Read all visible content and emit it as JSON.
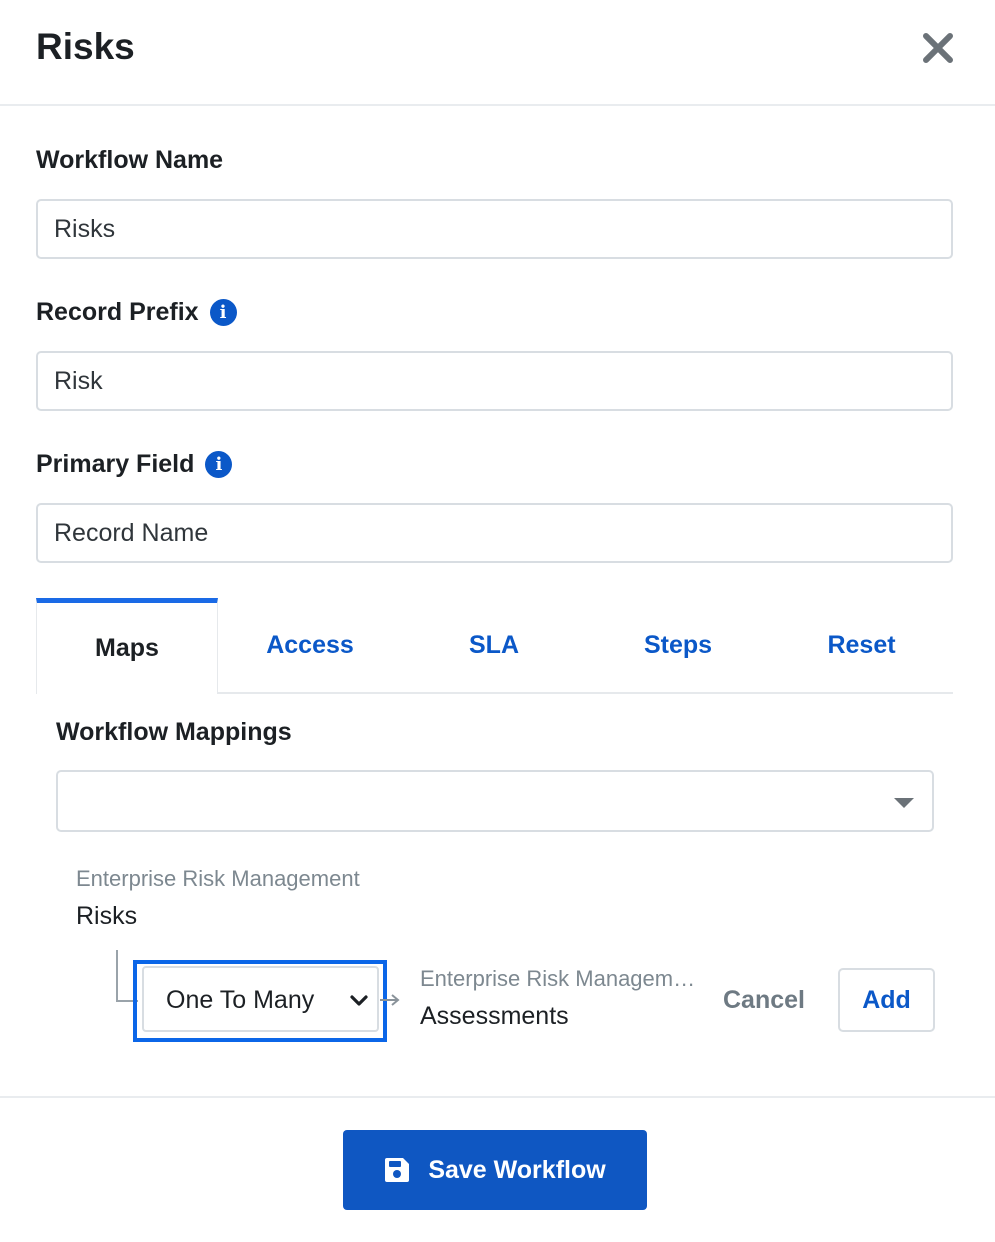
{
  "colors": {
    "accent": "#0b58c8",
    "focus_outline": "#0b66e8",
    "save_button": "#0f57c2",
    "muted_text": "#7d8890"
  },
  "header": {
    "title": "Risks",
    "close_icon": "close-icon"
  },
  "form": {
    "workflow_name": {
      "label": "Workflow Name",
      "value": "Risks"
    },
    "record_prefix": {
      "label": "Record Prefix",
      "value": "Risk",
      "icon": "info-icon"
    },
    "primary_field": {
      "label": "Primary Field",
      "value": "Record Name",
      "icon": "info-icon"
    }
  },
  "tabs": [
    {
      "label": "Maps",
      "active": true
    },
    {
      "label": "Access",
      "active": false
    },
    {
      "label": "SLA",
      "active": false
    },
    {
      "label": "Steps",
      "active": false
    },
    {
      "label": "Reset",
      "active": false
    }
  ],
  "mappings": {
    "section_title": "Workflow Mappings",
    "select_value": "",
    "source": {
      "group": "Enterprise Risk Management",
      "name": "Risks"
    },
    "relationship": {
      "value": "One To Many"
    },
    "target": {
      "group": "Enterprise Risk Management",
      "name": "Assessments"
    },
    "cancel_label": "Cancel",
    "add_label": "Add"
  },
  "footer": {
    "save_label": "Save Workflow",
    "save_icon": "floppy-disk-icon"
  }
}
